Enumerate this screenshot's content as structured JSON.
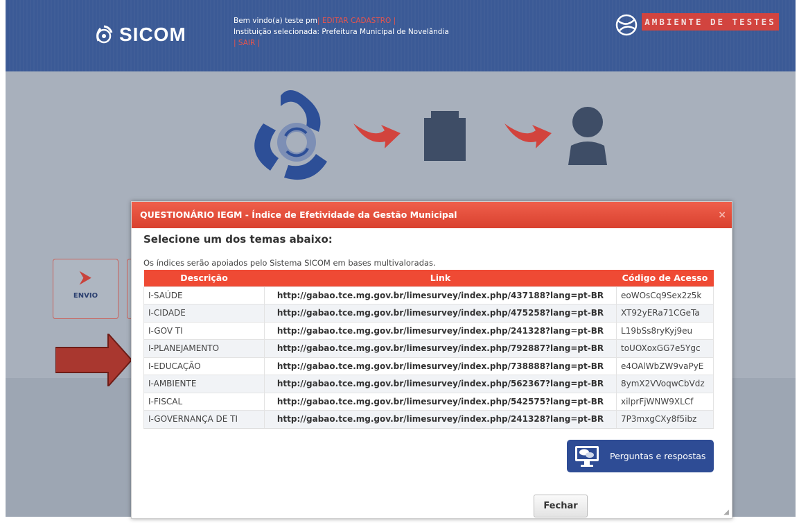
{
  "header": {
    "brand": "SICOM",
    "welcome_prefix": "Bem vindo(a) teste pm",
    "edit_link": "| EDITAR CADASTRO |",
    "institution_label": "Instituição selecionada: Prefeitura Municipal de Novelândia",
    "logout_link": "| SAIR |",
    "environment_badge": "AMBIENTE DE TESTES"
  },
  "sidebar_card": {
    "label": "ENVIO"
  },
  "modal": {
    "title": "QUESTIONÁRIO IEGM - Índice de Efetividade da Gestão Municipal",
    "close": "×",
    "heading": "Selecione um dos temas abaixo:",
    "subtitle": "Os índices serão apoiados pelo Sistema SICOM em bases multivaloradas.",
    "columns": [
      "Descrição",
      "Link",
      "Código de Acesso"
    ],
    "rows": [
      {
        "descricao": "I-SAÚDE",
        "link": "http://gabao.tce.mg.gov.br/limesurvey/index.php/437188?lang=pt-BR",
        "codigo": "eoWOsCq9Sex2z5k"
      },
      {
        "descricao": "I-CIDADE",
        "link": "http://gabao.tce.mg.gov.br/limesurvey/index.php/475258?lang=pt-BR",
        "codigo": "XT92yERa71CGeTa"
      },
      {
        "descricao": "I-GOV TI",
        "link": "http://gabao.tce.mg.gov.br/limesurvey/index.php/241328?lang=pt-BR",
        "codigo": "L19bSs8ryKyj9eu"
      },
      {
        "descricao": "I-PLANEJAMENTO",
        "link": "http://gabao.tce.mg.gov.br/limesurvey/index.php/792887?lang=pt-BR",
        "codigo": "toUOXoxGG7e5Ygc"
      },
      {
        "descricao": "I-EDUCAÇÃO",
        "link": "http://gabao.tce.mg.gov.br/limesurvey/index.php/738888?lang=pt-BR",
        "codigo": "e4OAlWbZW9vaPyE"
      },
      {
        "descricao": "I-AMBIENTE",
        "link": "http://gabao.tce.mg.gov.br/limesurvey/index.php/562367?lang=pt-BR",
        "codigo": "8ymX2VVoqwCbVdz"
      },
      {
        "descricao": "I-FISCAL",
        "link": "http://gabao.tce.mg.gov.br/limesurvey/index.php/542575?lang=pt-BR",
        "codigo": "xilprFjWNW9XLCf"
      },
      {
        "descricao": "I-GOVERNANÇA DE TI",
        "link": "http://gabao.tce.mg.gov.br/limesurvey/index.php/241328?lang=pt-BR",
        "codigo": "7P3mxgCXy8f5ibz"
      }
    ],
    "faq_button": "Perguntas e respostas",
    "close_button": "Fechar"
  },
  "colors": {
    "header_blue": "#3b5a96",
    "modal_red": "#ef4a34",
    "faq_blue": "#2e4c95",
    "callout_red": "#a9372f"
  }
}
